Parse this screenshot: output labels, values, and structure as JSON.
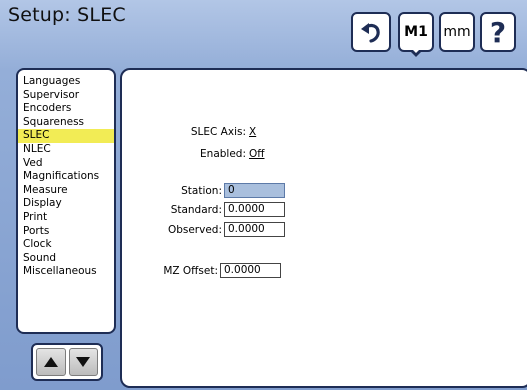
{
  "header": {
    "title": "Setup: SLEC",
    "buttons": {
      "undo_icon": "undo-arrow-icon",
      "m1_label": "M1",
      "mm_label": "mm",
      "help_label": "?"
    }
  },
  "sidebar": {
    "items": [
      {
        "label": "Languages"
      },
      {
        "label": "Supervisor"
      },
      {
        "label": "Encoders"
      },
      {
        "label": "Squareness"
      },
      {
        "label": "SLEC"
      },
      {
        "label": "NLEC"
      },
      {
        "label": "Ved"
      },
      {
        "label": "Magnifications"
      },
      {
        "label": "Measure"
      },
      {
        "label": "Display"
      },
      {
        "label": "Print"
      },
      {
        "label": "Ports"
      },
      {
        "label": "Clock"
      },
      {
        "label": "Sound"
      },
      {
        "label": "Miscellaneous"
      }
    ],
    "selected": "SLEC",
    "selected_color": "#f2ec55"
  },
  "nav_arrows": {
    "up_icon": "triangle-up-icon",
    "down_icon": "triangle-down-icon"
  },
  "form": {
    "slec_axis": {
      "label": "SLEC Axis:",
      "value": "X"
    },
    "enabled": {
      "label": "Enabled:",
      "value": "Off"
    },
    "station": {
      "label": "Station:",
      "value": "0"
    },
    "standard": {
      "label": "Standard:",
      "value": "0.0000"
    },
    "observed": {
      "label": "Observed:",
      "value": "0.0000"
    },
    "mz_offset": {
      "label": "MZ Offset:",
      "value": "0.0000"
    }
  },
  "colors": {
    "background": "#94aed8",
    "border": "#1e2d55",
    "active_field": "#a9bfdd"
  }
}
